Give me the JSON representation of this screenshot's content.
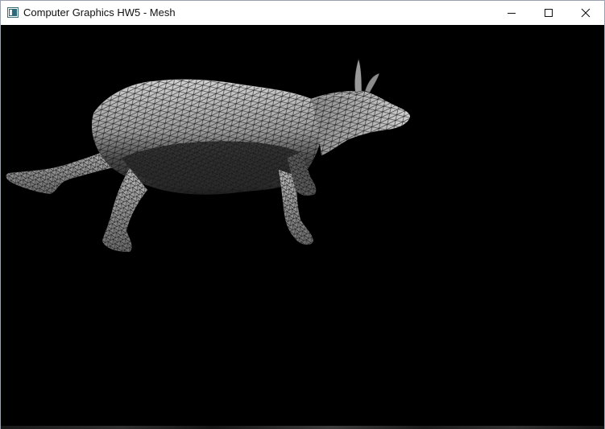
{
  "window": {
    "title": "Computer Graphics HW5 - Mesh"
  },
  "icons": {
    "app": "app-window-icon",
    "minimize": "minimize-icon",
    "maximize": "maximize-icon",
    "close": "close-icon"
  },
  "colors": {
    "titlebar": "#ffffff",
    "viewport_background": "#000000",
    "mesh_light": "#c8c8c8",
    "mesh_dark": "#3a3a3a",
    "wireframe": "#1a1a1a"
  }
}
